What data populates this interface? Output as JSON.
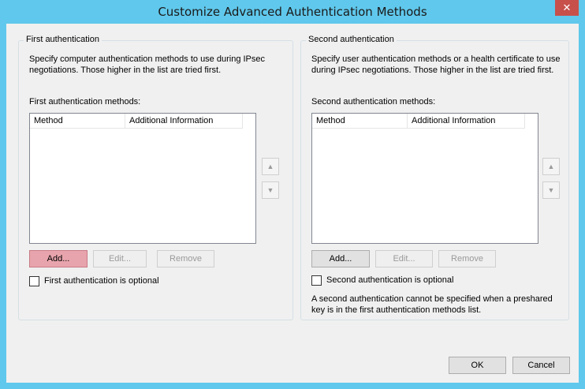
{
  "window": {
    "title": "Customize Advanced Authentication Methods",
    "close_glyph": "✕"
  },
  "first": {
    "legend": "First authentication",
    "desc_line1": "Specify computer authentication methods to use during IPsec",
    "desc_line2": "negotiations.  Those higher in the list are tried first.",
    "list_label": "First authentication methods:",
    "columns": [
      "Method",
      "Additional Information"
    ],
    "add_label": "Add...",
    "edit_label": "Edit...",
    "remove_label": "Remove",
    "optional_label": "First authentication is optional",
    "optional_checked": false
  },
  "second": {
    "legend": "Second authentication",
    "desc_line1": "Specify user authentication methods or a health certificate to use",
    "desc_line2": "during IPsec negotiations.  Those higher in the list are tried first.",
    "list_label": "Second authentication methods:",
    "columns": [
      "Method",
      "Additional Information"
    ],
    "add_label": "Add...",
    "edit_label": "Edit...",
    "remove_label": "Remove",
    "optional_label": "Second authentication is optional",
    "optional_checked": false,
    "note_line1": "A second authentication cannot be specified when a preshared",
    "note_line2": "key is in the first authentication methods list."
  },
  "arrows": {
    "up": "▲",
    "down": "▼"
  },
  "footer": {
    "ok_label": "OK",
    "cancel_label": "Cancel"
  }
}
